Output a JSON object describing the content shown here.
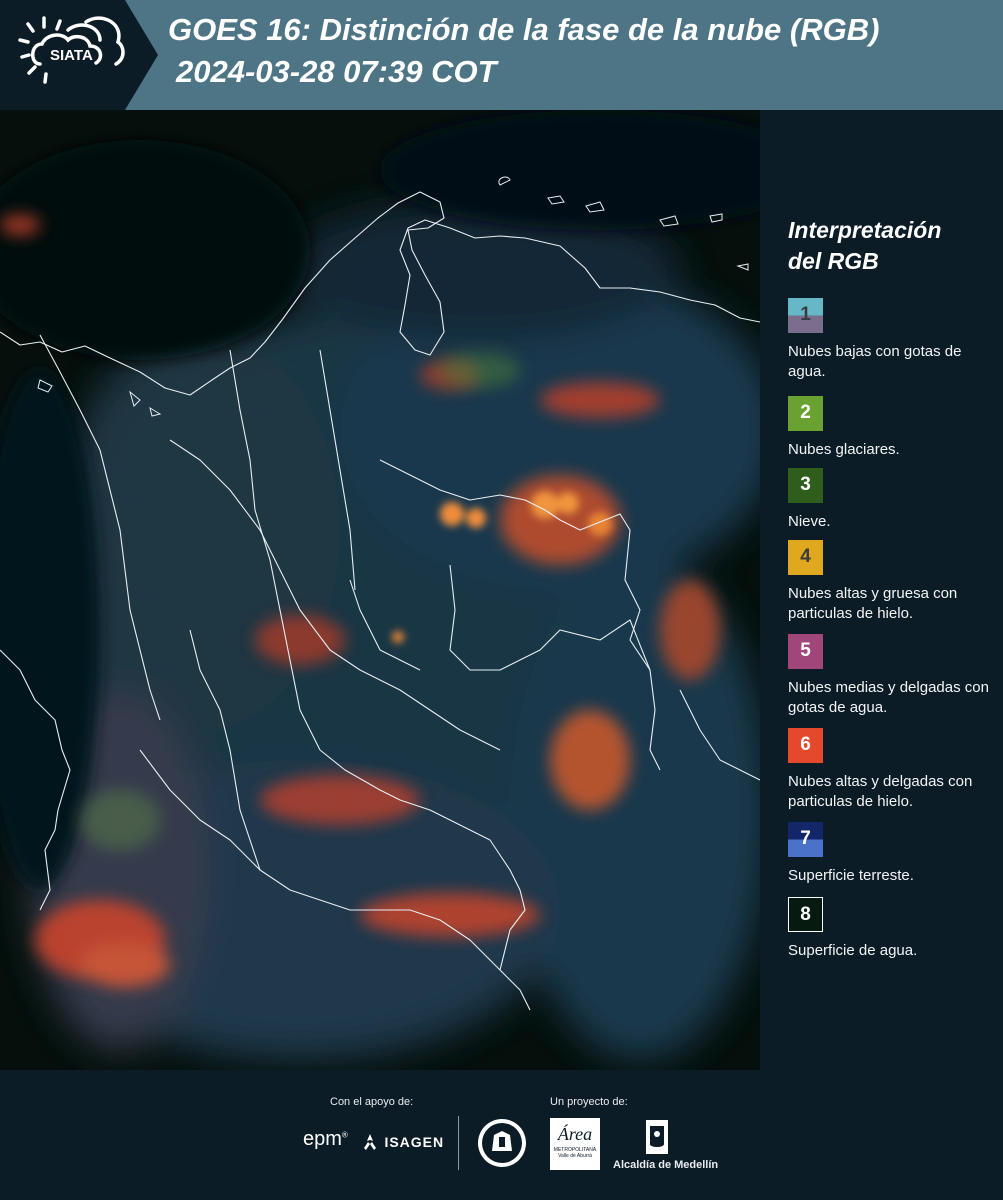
{
  "header": {
    "brand": "SIATA",
    "title_line1": "GOES 16: Distinción de la fase de la nube (RGB)",
    "title_line2": "2024-03-28 07:39 COT"
  },
  "legend": {
    "title_line1": "Interpretación",
    "title_line2": "del RGB",
    "items": [
      {
        "num": "1",
        "label": "Nubes bajas con gotas de agua.",
        "colors": [
          "#66b8c6",
          "#7a6e8c"
        ],
        "num_color": "#3a3a44"
      },
      {
        "num": "2",
        "label": "Nubes glaciares.",
        "colors": [
          "#6aa232"
        ],
        "num_color": "#ffffff"
      },
      {
        "num": "3",
        "label": "Nieve.",
        "colors": [
          "#2f5e1c"
        ],
        "num_color": "#ffffff"
      },
      {
        "num": "4",
        "label": "Nubes altas y gruesa con particulas de hielo.",
        "colors": [
          "#e0a81e"
        ],
        "num_color": "#3a3a3a"
      },
      {
        "num": "5",
        "label": "Nubes medias y delgadas con gotas de agua.",
        "colors": [
          "#a0467a"
        ],
        "num_color": "#ffffff"
      },
      {
        "num": "6",
        "label": "Nubes altas y delgadas con particulas de hielo.",
        "colors": [
          "#e5492c"
        ],
        "num_color": "#ffffff"
      },
      {
        "num": "7",
        "label": "Superficie terreste.",
        "colors": [
          "#14266a",
          "#4a72c8"
        ],
        "num_color": "#ffffff"
      },
      {
        "num": "8",
        "label": "Superficie de agua.",
        "colors": [
          "#071a10"
        ],
        "num_color": "#ffffff"
      }
    ]
  },
  "footer": {
    "support_label": "Con el apoyo de:",
    "project_label": "Un proyecto de:",
    "epm": "epm",
    "isagen": "ISAGEN",
    "area_metro": "Área",
    "area_metro_sub1": "METROPOLITANA",
    "area_metro_sub2": "Valle de Aburrá",
    "alcaldia": "Alcaldía de Medellín"
  }
}
